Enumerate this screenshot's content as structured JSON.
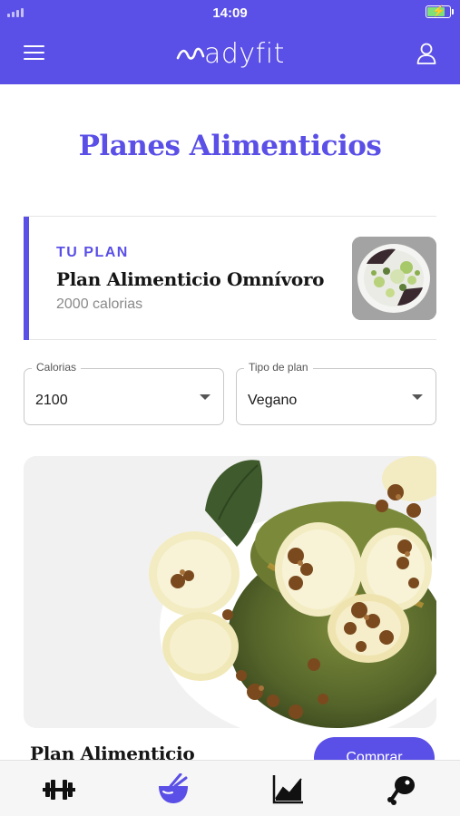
{
  "status_bar": {
    "time": "14:09"
  },
  "header": {
    "logo_text": "adyfit",
    "menu_icon": "hamburger-menu-icon",
    "user_icon": "user-icon"
  },
  "page": {
    "title": "Planes Alimenticios"
  },
  "current_plan": {
    "tag": "TU PLAN",
    "name": "Plan Alimenticio Omnívoro",
    "calories": "2000 calorias"
  },
  "filters": {
    "calories": {
      "label": "Calorias",
      "value": "2100"
    },
    "plan_type": {
      "label": "Tipo de plan",
      "value": "Vegano"
    }
  },
  "plan_card": {
    "title": "Plan Alimenticio",
    "buy_label": "Comprar"
  },
  "bottom_nav": [
    {
      "icon": "dumbbell-icon"
    },
    {
      "icon": "bowl-icon",
      "active": true
    },
    {
      "icon": "chart-icon"
    },
    {
      "icon": "drumstick-icon"
    }
  ],
  "colors": {
    "brand": "#5a4fe6",
    "nav_inactive": "#111111"
  }
}
